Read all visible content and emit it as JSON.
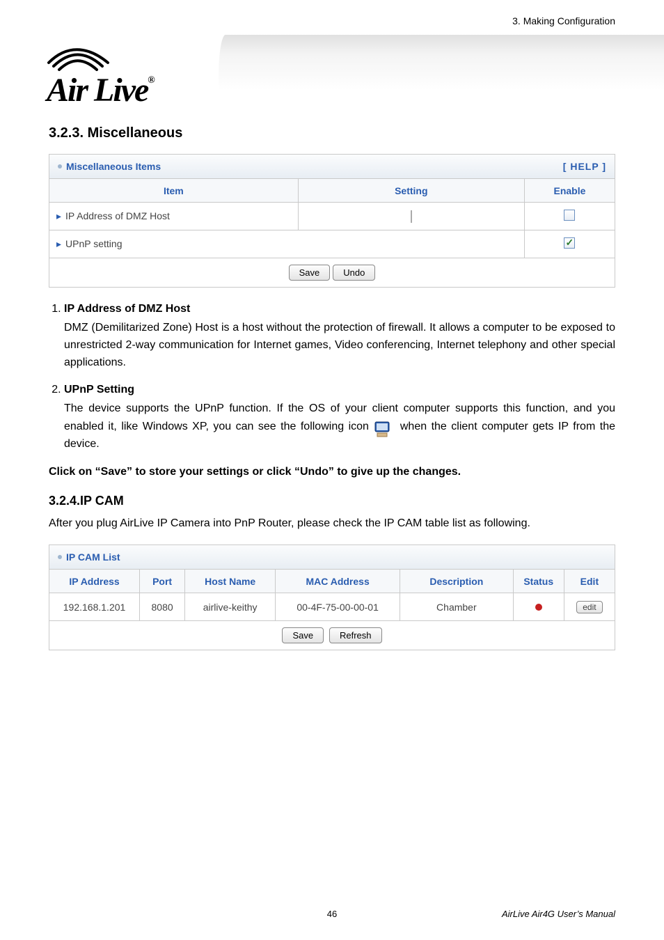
{
  "header": {
    "top_right": "3. Making Configuration",
    "logo_text": "Air Live",
    "logo_reg": "®"
  },
  "section_misc": {
    "heading": "3.2.3.  Miscellaneous",
    "panel_title": "Miscellaneous Items",
    "help_label": "[ HELP ]",
    "columns": {
      "item": "Item",
      "setting": "Setting",
      "enable": "Enable"
    },
    "rows": [
      {
        "label": "IP Address of DMZ Host",
        "has_setting_input": true,
        "checked": false
      },
      {
        "label": "UPnP setting",
        "span_setting": true,
        "checked": true
      }
    ],
    "buttons": {
      "save": "Save",
      "undo": "Undo"
    }
  },
  "list": {
    "items": [
      {
        "title": "IP Address of DMZ Host",
        "body": "DMZ (Demilitarized Zone) Host is a host without the protection of firewall. It allows a computer to be exposed to unrestricted 2-way communication for Internet games, Video conferencing, Internet telephony and other special applications."
      },
      {
        "title": "UPnP Setting",
        "body_pre_icon": "The device supports the UPnP function. If the OS of your client computer supports this function, and you enabled it, like Windows XP, you can see the following icon",
        "body_post_icon": "when the client computer gets IP from the device."
      }
    ]
  },
  "save_line": "Click on “Save” to store your settings or click “Undo” to give up the changes.",
  "section_ipcam": {
    "heading": "3.2.4.IP CAM",
    "intro": "After you plug AirLive IP Camera into PnP Router, please check the IP CAM table list as following.",
    "panel_title": "IP CAM List",
    "columns": {
      "ip": "IP Address",
      "port": "Port",
      "host": "Host Name",
      "mac": "MAC Address",
      "desc": "Description",
      "status": "Status",
      "edit": "Edit"
    },
    "rows": [
      {
        "ip": "192.168.1.201",
        "port": "8080",
        "host": "airlive-keithy",
        "mac": "00-4F-75-00-00-01",
        "desc": "Chamber",
        "status": "red",
        "edit_label": "edit"
      }
    ],
    "buttons": {
      "save": "Save",
      "refresh": "Refresh"
    }
  },
  "footer": {
    "page": "46",
    "right": "AirLive Air4G User’s Manual"
  }
}
